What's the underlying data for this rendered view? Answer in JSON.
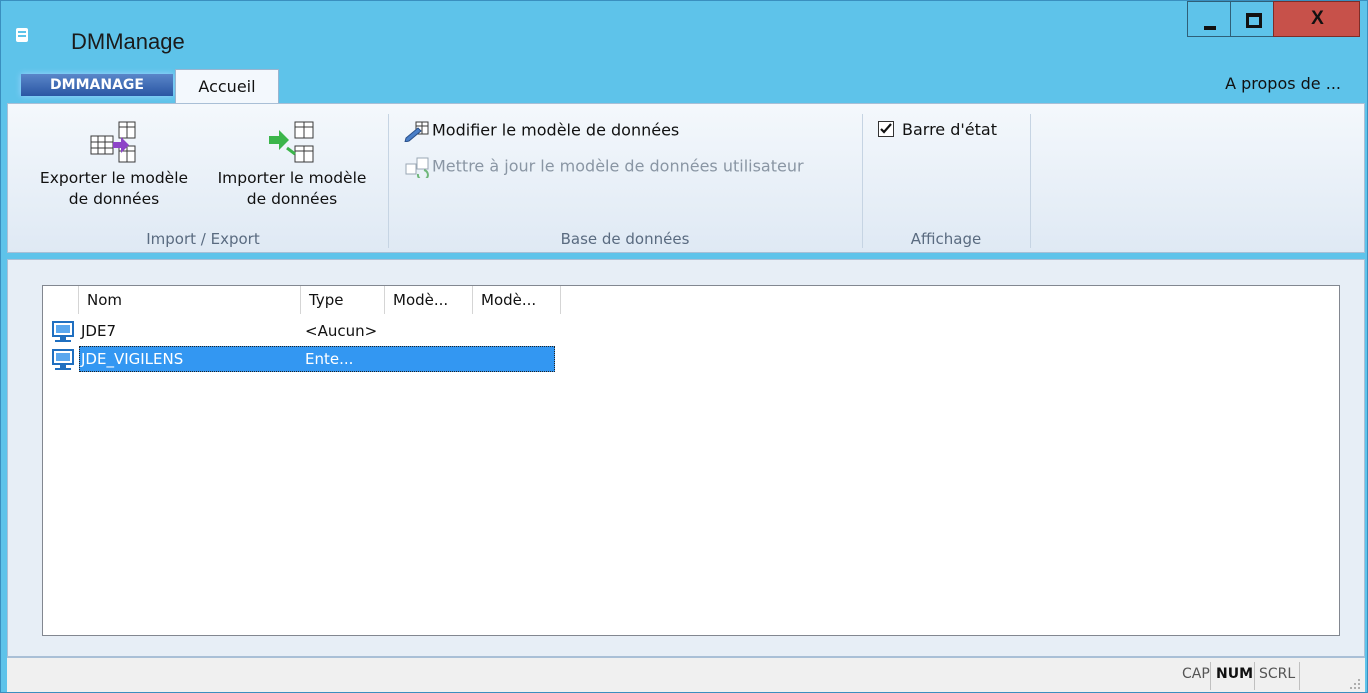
{
  "window": {
    "title": "DMManage"
  },
  "tabs": {
    "app_tab": "DMMANAGE",
    "home_tab": "Accueil",
    "about": "A propos de ..."
  },
  "ribbon": {
    "export": {
      "line1": "Exporter le modèle",
      "line2": "de données"
    },
    "import": {
      "line1": "Importer le modèle",
      "line2": "de données"
    },
    "group_import_export": "Import / Export",
    "modify_model": "Modifier le modèle de données",
    "update_user_model": "Mettre à jour le modèle de données utilisateur",
    "group_database": "Base de données",
    "status_bar_check": "Barre d'état",
    "group_display": "Affichage"
  },
  "list": {
    "columns": [
      "Nom",
      "Type",
      "Modè...",
      "Modè..."
    ],
    "rows": [
      {
        "name": "JDE7",
        "type": "<Aucun>"
      },
      {
        "name": "JDE_VIGILENS",
        "type": "Ente..."
      }
    ]
  },
  "statusbar": {
    "cap": "CAP",
    "num": "NUM",
    "scrl": "SCRL"
  },
  "colors": {
    "title_bar": "#5ec3ea",
    "close_button": "#c7514a",
    "selection": "#3397f2"
  }
}
